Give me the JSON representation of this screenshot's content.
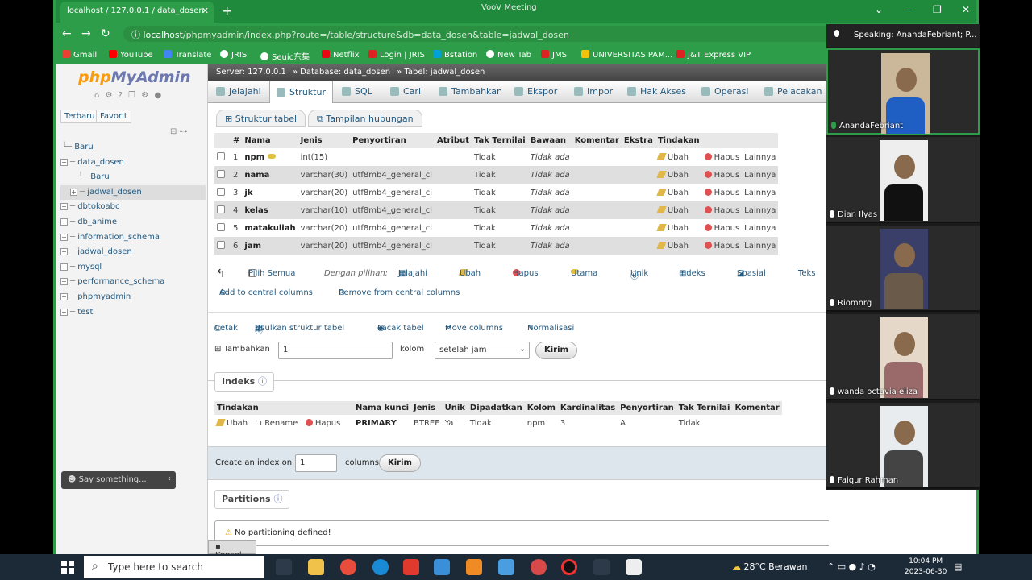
{
  "browser": {
    "tab_title": "localhost / 127.0.0.1 / data_dosen",
    "tab_close": "✕",
    "new_tab": "+",
    "voov_title": "VooV Meeting",
    "url_host": "localhost",
    "url_path": "/phpmyadmin/index.php?route=/table/structure&db=data_dosen&table=jadwal_dosen",
    "bookmarks": [
      "Gmail",
      "YouTube",
      "Translate",
      "JRIS",
      "Seuic东集",
      "Netflix",
      "Login | JRIS",
      "Bstation",
      "New Tab",
      "JMS",
      "UNIVERSITAS PAM...",
      "J&T Express VIP"
    ]
  },
  "sidebar": {
    "logo_php": "php",
    "logo_rest": "MyAdmin",
    "tab_recent": "Terbaru",
    "tab_fav": "Favorit",
    "tree": [
      {
        "label": "Baru",
        "level": 1
      },
      {
        "label": "data_dosen",
        "level": 1
      },
      {
        "label": "Baru",
        "level": 2
      },
      {
        "label": "jadwal_dosen",
        "level": 2
      },
      {
        "label": "dbtokoabc",
        "level": 1
      },
      {
        "label": "db_anime",
        "level": 1
      },
      {
        "label": "information_schema",
        "level": 1
      },
      {
        "label": "jadwal_dosen",
        "level": 1
      },
      {
        "label": "mysql",
        "level": 1
      },
      {
        "label": "performance_schema",
        "level": 1
      },
      {
        "label": "phpmyadmin",
        "level": 1
      },
      {
        "label": "test",
        "level": 1
      }
    ],
    "say_something": "Say something..."
  },
  "breadcrumb": {
    "server": "Server: 127.0.0.1",
    "database": "Database: data_dosen",
    "table": "Tabel: jadwal_dosen"
  },
  "menu": [
    "Jelajahi",
    "Struktur",
    "SQL",
    "Cari",
    "Tambahkan",
    "Ekspor",
    "Impor",
    "Hak Akses",
    "Operasi",
    "Pelacakan"
  ],
  "subtabs": [
    "Struktur tabel",
    "Tampilan hubungan"
  ],
  "structure": {
    "headers": [
      "#",
      "Nama",
      "Jenis",
      "Penyortiran",
      "Atribut",
      "Tak Ternilai",
      "Bawaan",
      "Komentar",
      "Ekstra",
      "Tindakan"
    ],
    "rows": [
      {
        "no": "1",
        "name": "npm",
        "type": "int(15)",
        "collation": "",
        "null": "Tidak",
        "default": "Tidak ada"
      },
      {
        "no": "2",
        "name": "nama",
        "type": "varchar(30)",
        "collation": "utf8mb4_general_ci",
        "null": "Tidak",
        "default": "Tidak ada"
      },
      {
        "no": "3",
        "name": "jk",
        "type": "varchar(20)",
        "collation": "utf8mb4_general_ci",
        "null": "Tidak",
        "default": "Tidak ada"
      },
      {
        "no": "4",
        "name": "kelas",
        "type": "varchar(10)",
        "collation": "utf8mb4_general_ci",
        "null": "Tidak",
        "default": "Tidak ada"
      },
      {
        "no": "5",
        "name": "matakuliah",
        "type": "varchar(20)",
        "collation": "utf8mb4_general_ci",
        "null": "Tidak",
        "default": "Tidak ada"
      },
      {
        "no": "6",
        "name": "jam",
        "type": "varchar(20)",
        "collation": "utf8mb4_general_ci",
        "null": "Tidak",
        "default": "Tidak ada"
      }
    ],
    "action_edit": "Ubah",
    "action_delete": "Hapus",
    "action_more": "Lainnya"
  },
  "bulk": {
    "select_all": "Pilih Semua",
    "with_selected": "Dengan pilihan:",
    "actions": [
      "Jelajahi",
      "Ubah",
      "Hapus",
      "Utama",
      "Unik",
      "Indeks",
      "Spasial",
      "Teks"
    ],
    "add_central": "Add to central columns",
    "remove_central": "Remove from central columns"
  },
  "tools": {
    "print": "Cetak",
    "propose": "Usulkan struktur tabel",
    "track": "Lacak tabel",
    "move": "Move columns",
    "normalize": "Normalisasi",
    "add_label": "Tambahkan",
    "add_value": "1",
    "columns_label": "kolom",
    "after_select": "setelah jam",
    "go": "Kirim"
  },
  "indexes": {
    "legend": "Indeks",
    "headers": [
      "Tindakan",
      "Nama kunci",
      "Jenis",
      "Unik",
      "Dipadatkan",
      "Kolom",
      "Kardinalitas",
      "Penyortiran",
      "Tak Ternilai",
      "Komentar"
    ],
    "row": {
      "edit": "Ubah",
      "rename": "Rename",
      "delete": "Hapus",
      "key": "PRIMARY",
      "type": "BTREE",
      "unique": "Ya",
      "packed": "Tidak",
      "column": "npm",
      "cardinality": "3",
      "collation": "A",
      "null": "Tidak"
    },
    "create_label": "Create an index on",
    "create_value": "1",
    "create_columns": "columns",
    "create_go": "Kirim"
  },
  "partitions": {
    "legend": "Partitions",
    "message": "No partitioning defined!"
  },
  "console": "Konsol",
  "meeting": {
    "speaking": "Speaking: AnandaFebriant; P...",
    "participants": [
      "AnandaFebriant",
      "Dian Ilyas",
      "Riomnrg",
      "wanda octavia eliza",
      "Faiqur Rahman"
    ]
  },
  "taskbar": {
    "search_placeholder": "Type here to search",
    "weather": "28°C Berawan",
    "time": "10:04 PM",
    "date": "2023-06-30"
  }
}
